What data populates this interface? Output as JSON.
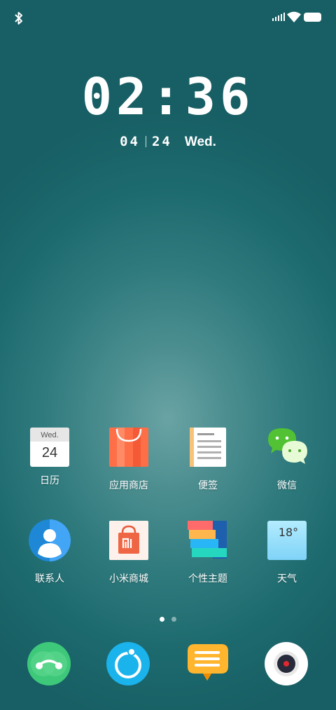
{
  "clock": {
    "time": "02:36",
    "month": "04",
    "day": "24",
    "weekday": "Wed."
  },
  "calendar_icon": {
    "weekday": "Wed.",
    "day": "24"
  },
  "weather_icon": {
    "temp": "18°"
  },
  "apps_row1": [
    {
      "label": "日历",
      "icon": "calendar-icon"
    },
    {
      "label": "应用商店",
      "icon": "app-store-icon"
    },
    {
      "label": "便签",
      "icon": "notes-icon"
    },
    {
      "label": "微信",
      "icon": "wechat-icon"
    }
  ],
  "apps_row2": [
    {
      "label": "联系人",
      "icon": "contacts-icon"
    },
    {
      "label": "小米商城",
      "icon": "mi-store-icon"
    },
    {
      "label": "个性主题",
      "icon": "themes-icon"
    },
    {
      "label": "天气",
      "icon": "weather-icon"
    }
  ],
  "dock": [
    "phone-icon",
    "browser-icon",
    "messages-icon",
    "camera-icon"
  ],
  "page_indicator": {
    "pages": 2,
    "current": 1
  },
  "colors": {
    "wechat": "#52c234",
    "store": "#ff7043",
    "contacts": "#2196f3"
  }
}
